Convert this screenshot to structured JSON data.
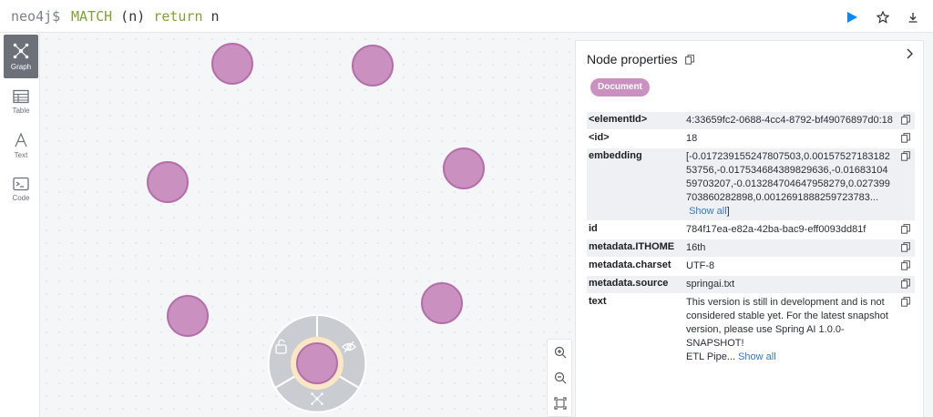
{
  "query": {
    "prompt": "neo4j$",
    "keyword_match": "MATCH",
    "middle": " (n) ",
    "keyword_return": "return",
    "tail": " n"
  },
  "sidebar": {
    "items": [
      {
        "label": "Graph",
        "icon": "graph-icon",
        "active": true
      },
      {
        "label": "Table",
        "icon": "table-icon",
        "active": false
      },
      {
        "label": "Text",
        "icon": "text-icon",
        "active": false
      },
      {
        "label": "Code",
        "icon": "code-icon",
        "active": false
      }
    ]
  },
  "colors": {
    "node_fill": "#c990c0",
    "node_stroke": "#b46eaa",
    "accent": "#018bff",
    "keyword": "#7fa333",
    "link": "#3478c6"
  },
  "properties": {
    "title": "Node properties",
    "label": "Document",
    "rows": [
      {
        "key": "<elementId>",
        "value": "4:33659fc2-0688-4cc4-8792-bf49076897d0:18"
      },
      {
        "key": "<id>",
        "value": "18"
      },
      {
        "key": "embedding",
        "value": "[-0.017239155247807503,0.00157527183182 53756,-0.017534684389829636,-0.01683104 59703207,-0.013284704647958279,0.027399 703860282898,0.0012691888259723783...",
        "show_all": "Show all",
        "suffix": "]"
      },
      {
        "key": "id",
        "value": "784f17ea-e82a-42ba-bac9-eff0093dd81f"
      },
      {
        "key": "metadata.ITHOME",
        "value": "16th"
      },
      {
        "key": "metadata.charset",
        "value": "UTF-8"
      },
      {
        "key": "metadata.source",
        "value": "springai.txt"
      },
      {
        "key": "text",
        "value": "This version is still in development and is not considered stable yet. For the latest snapshot version, please use Spring AI 1.0.0-SNAPSHOT!",
        "value2": "ETL Pipe...",
        "show_all": "Show all"
      }
    ]
  }
}
